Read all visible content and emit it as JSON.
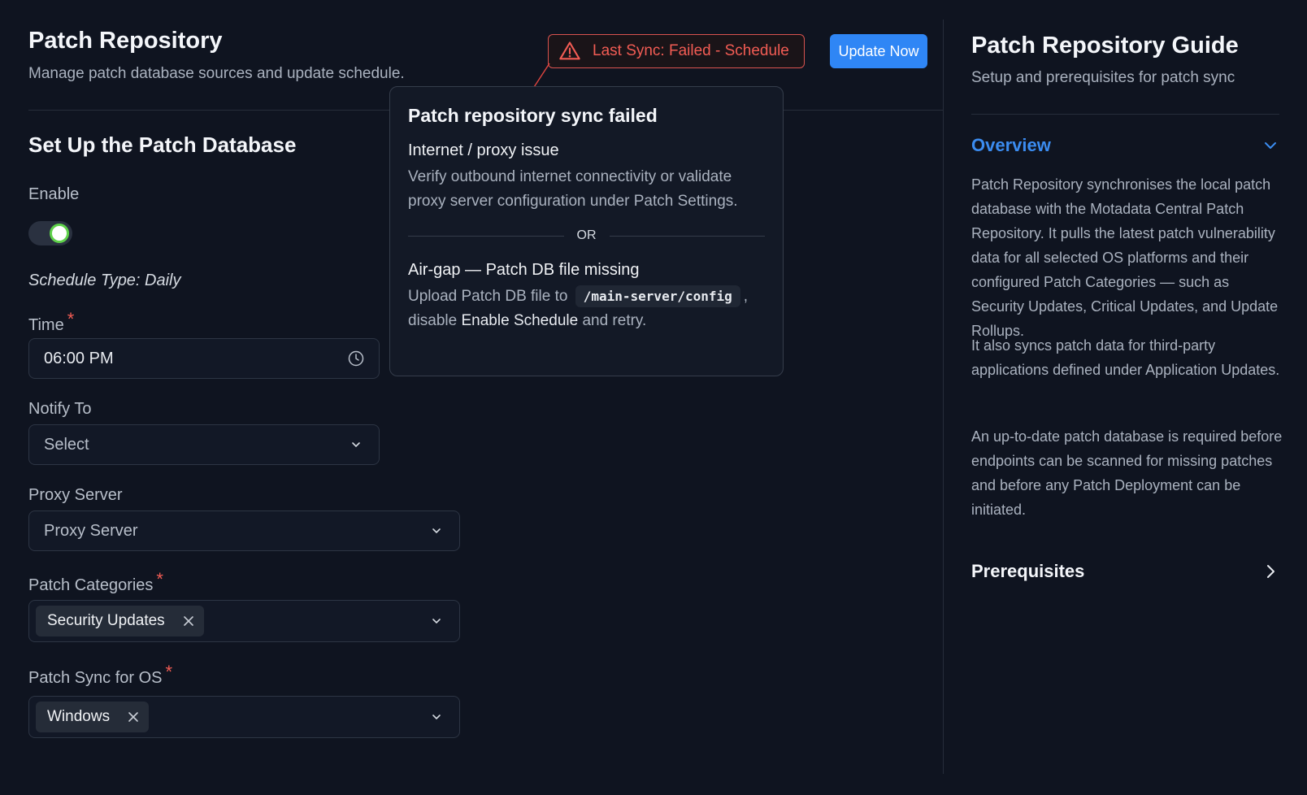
{
  "header": {
    "title": "Patch Repository",
    "subtitle": "Manage patch database sources and update schedule.",
    "sync_status": "Last Sync: Failed - Schedule",
    "update_button": "Update Now"
  },
  "form": {
    "section_title": "Set Up the Patch Database",
    "enable_label": "Enable",
    "enable_value": true,
    "schedule_type": "Schedule Type: Daily",
    "time_label": "Time",
    "time_value": "06:00 PM",
    "notify_label": "Notify To",
    "notify_placeholder": "Select",
    "proxy_label": "Proxy Server",
    "proxy_placeholder": "Proxy Server",
    "categories_label": "Patch Categories",
    "categories_chips": [
      "Security Updates"
    ],
    "os_label": "Patch Sync for OS",
    "os_chips": [
      "Windows"
    ],
    "required_mark": "*"
  },
  "popover": {
    "title": "Patch repository sync failed",
    "issue1_heading": "Internet / proxy issue",
    "issue1_text": "Verify outbound internet connectivity or validate proxy server configuration under Patch Settings.",
    "separator": "OR",
    "issue2_heading": "Air-gap — Patch DB file missing",
    "issue2_text_before": "Upload Patch DB file to",
    "issue2_code": "/main-server/config",
    "issue2_comma": ",",
    "issue2_text_mid": "disable",
    "issue2_emphasis": "Enable Schedule",
    "issue2_text_after": "and retry."
  },
  "guide": {
    "title": "Patch Repository Guide",
    "subtitle": "Setup and prerequisites for patch sync",
    "overview_label": "Overview",
    "overview_p1": "Patch Repository synchronises the local patch database with the Motadata Central Patch Repository. It pulls the latest patch vulnerability data for all selected OS platforms and their configured Patch Categories — such as Security Updates, Critical Updates, and Update Rollups.",
    "overview_p2": "It also syncs patch data for third-party applications defined under Application Updates.",
    "overview_p3": "An up-to-date patch database is required before endpoints can be scanned for missing patches and before any Patch Deployment can be initiated.",
    "prerequisites_label": "Prerequisites"
  },
  "colors": {
    "accent": "#2f86f5",
    "error": "#f25c54",
    "toggle_on": "#5fd14a",
    "background": "#0f1420"
  },
  "icons": [
    "warning-icon",
    "clock-icon",
    "chevron-down-icon",
    "close-icon",
    "chevron-right-icon"
  ]
}
